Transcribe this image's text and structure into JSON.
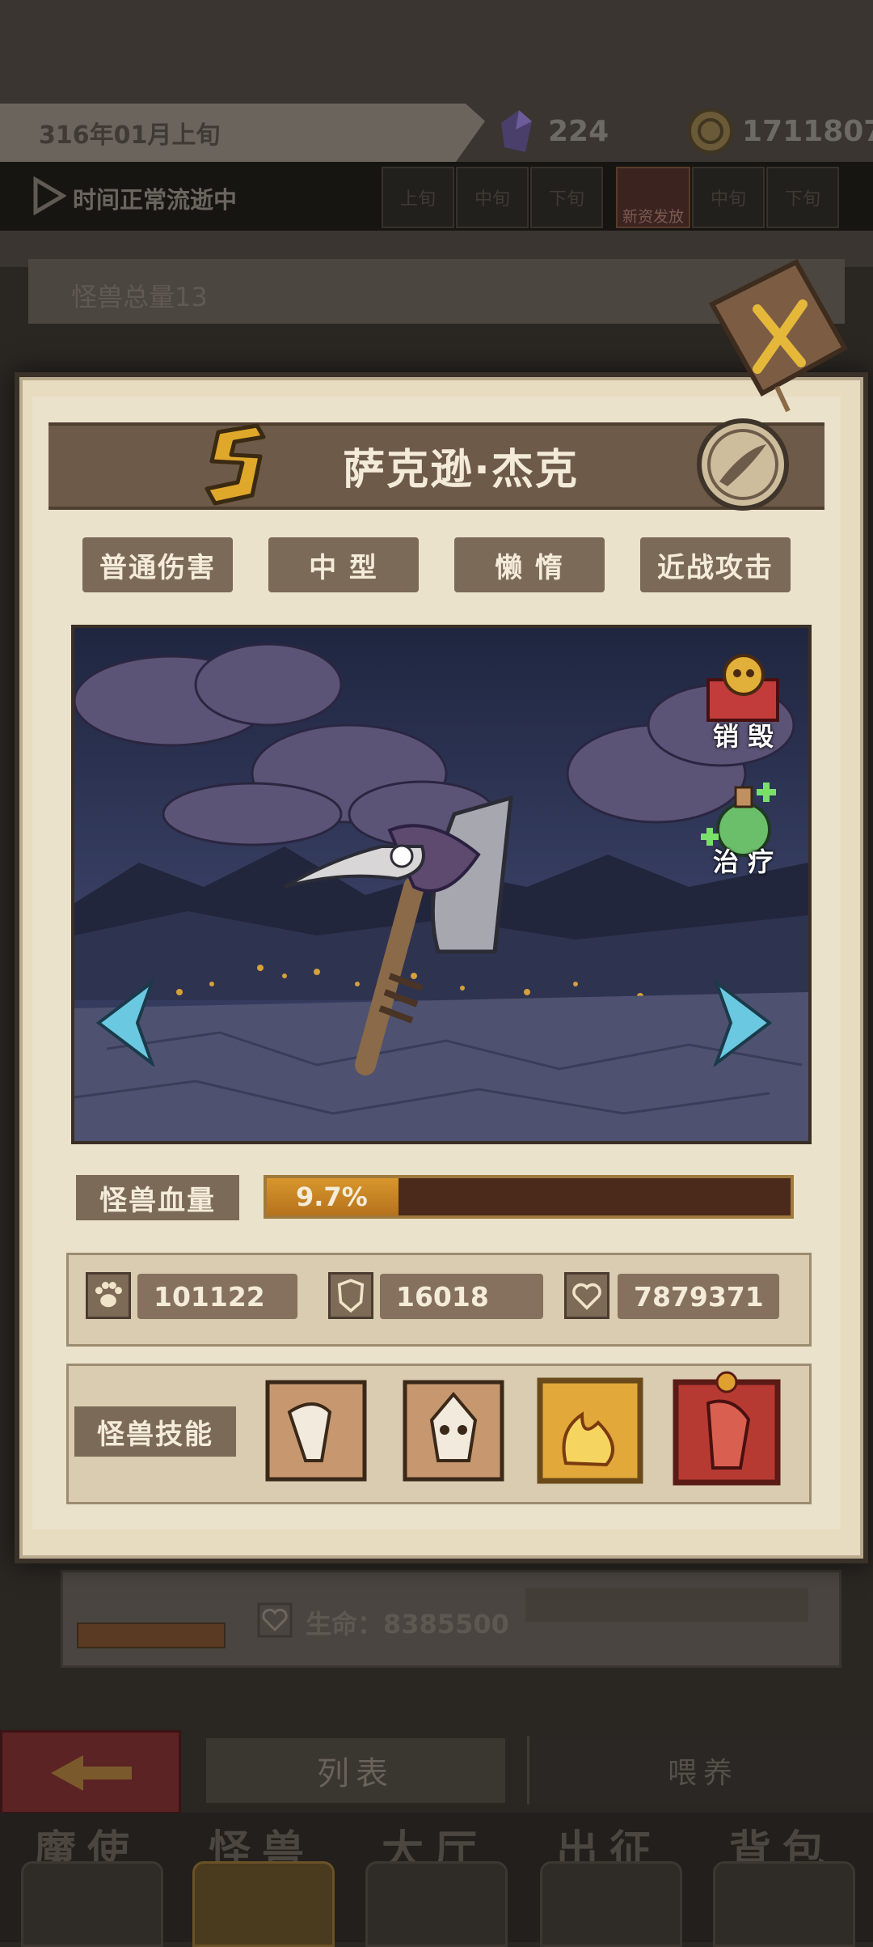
{
  "header": {
    "date": "316年01月上旬",
    "crystal_count": "224",
    "coin_count": "1711807",
    "time_status": "时间正常流逝中",
    "time_slots": [
      "上旬",
      "中旬",
      "下旬",
      "新资发放",
      "中旬",
      "下旬"
    ],
    "monster_total": "怪兽总量13"
  },
  "modal": {
    "name": "萨克逊·杰克",
    "rank": "S",
    "tags": [
      "普通伤害",
      "中 型",
      "懒 惰",
      "近战攻击"
    ],
    "actions": {
      "destroy": "销 毁",
      "heal": "治 疗"
    },
    "hp_label": "怪兽血量",
    "hp_percent": "9.7%",
    "hp_fraction": 0.097,
    "stats": {
      "attack": "101122",
      "defense": "16018",
      "life": "7879371"
    },
    "skills_label": "怪兽技能",
    "skills": [
      "skill-claw-icon",
      "skill-rage-icon",
      "skill-fire-icon",
      "skill-demon-icon"
    ]
  },
  "background": {
    "life_text": "生命：8385500",
    "list_button": "列表",
    "feed_button": "喂养"
  },
  "nav": {
    "items": [
      "魔使",
      "怪兽",
      "大厅",
      "出征",
      "背包"
    ],
    "active": "怪兽"
  },
  "colors": {
    "panel": "#e8dcc0",
    "tag": "#7c6a58",
    "hp_fill": "#d8962c",
    "accent_gold": "#d4a02a"
  }
}
